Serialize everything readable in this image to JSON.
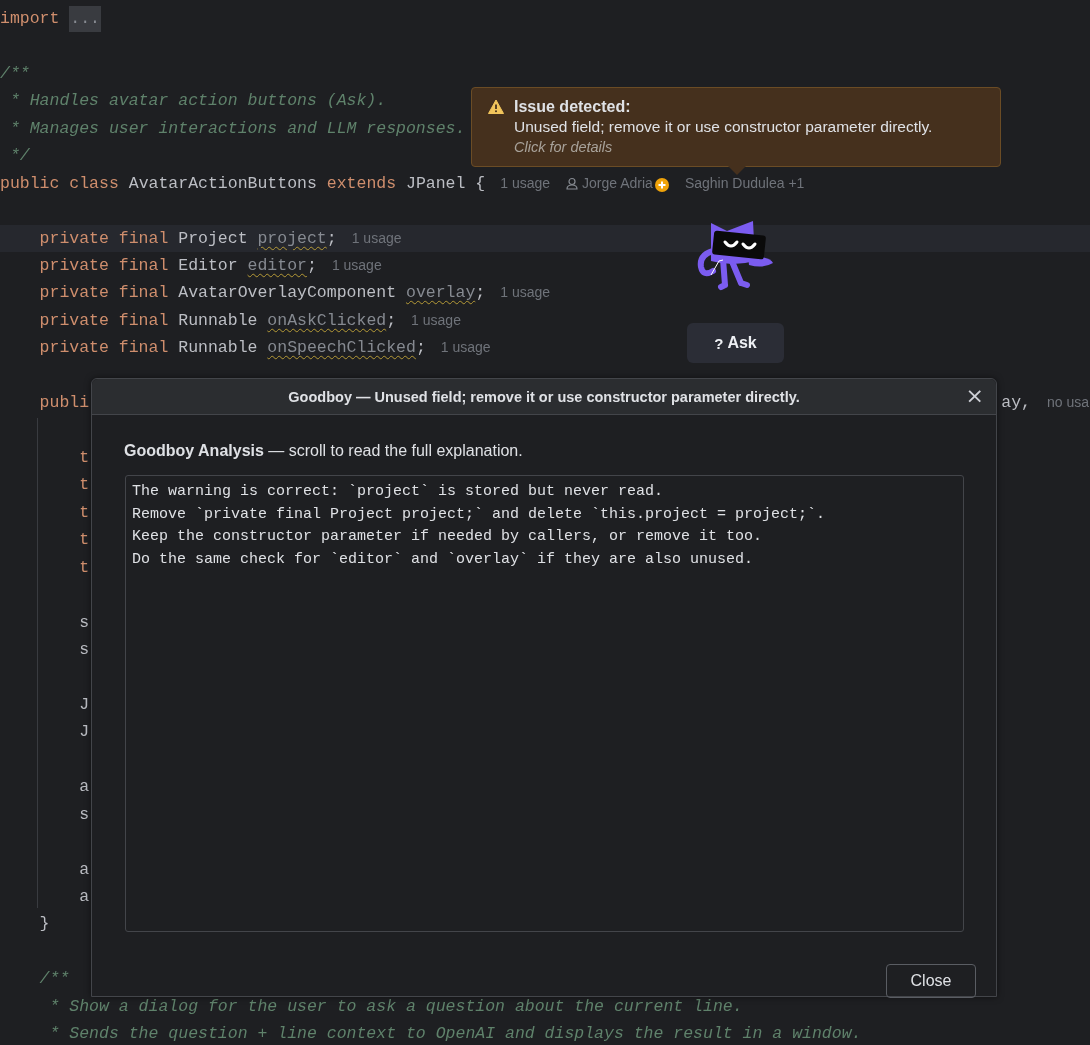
{
  "editor": {
    "lines": [
      {
        "kind": "code",
        "segments": [
          {
            "kind": "keyword",
            "text": "import "
          },
          {
            "kind": "fold",
            "text": "..."
          }
        ]
      },
      {
        "kind": "blank"
      },
      {
        "kind": "code",
        "segments": [
          {
            "kind": "comment",
            "text": "/**"
          }
        ]
      },
      {
        "kind": "code",
        "segments": [
          {
            "kind": "comment",
            "text": " * Handles avatar action buttons (Ask)."
          }
        ]
      },
      {
        "kind": "code",
        "segments": [
          {
            "kind": "comment",
            "text": " * Manages user interactions and LLM responses."
          }
        ]
      },
      {
        "kind": "code",
        "segments": [
          {
            "kind": "comment",
            "text": " */"
          }
        ]
      },
      {
        "kind": "code",
        "segments": [
          {
            "kind": "keyword",
            "text": "public class "
          },
          {
            "kind": "plain",
            "text": "AvatarActionButtons "
          },
          {
            "kind": "keyword",
            "text": "extends "
          },
          {
            "kind": "plain",
            "text": "JPanel {"
          },
          {
            "kind": "hint",
            "text": "1 usage"
          },
          {
            "kind": "author",
            "text": "Jorge Adria"
          },
          {
            "kind": "add-badge"
          },
          {
            "kind": "hint",
            "text": "Saghin Dudulea +1"
          }
        ]
      },
      {
        "kind": "blank"
      },
      {
        "kind": "code",
        "current": true,
        "segments": [
          {
            "kind": "keyword",
            "text": "    private final "
          },
          {
            "kind": "plain",
            "text": "Project "
          },
          {
            "kind": "unused",
            "text": "project"
          },
          {
            "kind": "plain",
            "text": ";"
          },
          {
            "kind": "hint",
            "text": "1 usage"
          }
        ]
      },
      {
        "kind": "code",
        "segments": [
          {
            "kind": "keyword",
            "text": "    private final "
          },
          {
            "kind": "plain",
            "text": "Editor "
          },
          {
            "kind": "unused",
            "text": "editor"
          },
          {
            "kind": "plain",
            "text": ";"
          },
          {
            "kind": "hint",
            "text": "1 usage"
          }
        ]
      },
      {
        "kind": "code",
        "segments": [
          {
            "kind": "keyword",
            "text": "    private final "
          },
          {
            "kind": "plain",
            "text": "AvatarOverlayComponent "
          },
          {
            "kind": "unused",
            "text": "overlay"
          },
          {
            "kind": "plain",
            "text": ";"
          },
          {
            "kind": "hint",
            "text": "1 usage"
          }
        ]
      },
      {
        "kind": "code",
        "segments": [
          {
            "kind": "keyword",
            "text": "    private final "
          },
          {
            "kind": "plain",
            "text": "Runnable "
          },
          {
            "kind": "unused",
            "text": "onAskClicked"
          },
          {
            "kind": "plain",
            "text": ";"
          },
          {
            "kind": "hint",
            "text": "1 usage"
          }
        ]
      },
      {
        "kind": "code",
        "segments": [
          {
            "kind": "keyword",
            "text": "    private final "
          },
          {
            "kind": "plain",
            "text": "Runnable "
          },
          {
            "kind": "unused",
            "text": "onSpeechClicked"
          },
          {
            "kind": "plain",
            "text": ";"
          },
          {
            "kind": "hint",
            "text": "1 usage"
          }
        ]
      },
      {
        "kind": "blank"
      },
      {
        "kind": "code",
        "segments": [
          {
            "kind": "keyword",
            "text": "    publi"
          }
        ],
        "tail": [
          {
            "kind": "plain",
            "text": "ay,"
          },
          {
            "kind": "hint",
            "text": "no usa"
          }
        ]
      },
      {
        "kind": "blank"
      },
      {
        "kind": "code",
        "segments": [
          {
            "kind": "keyword",
            "text": "        t"
          }
        ]
      },
      {
        "kind": "code",
        "segments": [
          {
            "kind": "keyword",
            "text": "        t"
          }
        ]
      },
      {
        "kind": "code",
        "segments": [
          {
            "kind": "keyword",
            "text": "        t"
          }
        ]
      },
      {
        "kind": "code",
        "segments": [
          {
            "kind": "keyword",
            "text": "        t"
          }
        ]
      },
      {
        "kind": "code",
        "segments": [
          {
            "kind": "keyword",
            "text": "        t"
          }
        ]
      },
      {
        "kind": "blank"
      },
      {
        "kind": "code",
        "segments": [
          {
            "kind": "plain",
            "text": "        s"
          }
        ]
      },
      {
        "kind": "code",
        "segments": [
          {
            "kind": "plain",
            "text": "        s"
          }
        ]
      },
      {
        "kind": "blank"
      },
      {
        "kind": "code",
        "segments": [
          {
            "kind": "plain",
            "text": "        J"
          }
        ]
      },
      {
        "kind": "code",
        "segments": [
          {
            "kind": "plain",
            "text": "        J"
          }
        ]
      },
      {
        "kind": "blank"
      },
      {
        "kind": "code",
        "segments": [
          {
            "kind": "plain",
            "text": "        a"
          }
        ]
      },
      {
        "kind": "code",
        "segments": [
          {
            "kind": "plain",
            "text": "        s"
          }
        ]
      },
      {
        "kind": "blank"
      },
      {
        "kind": "code",
        "segments": [
          {
            "kind": "plain",
            "text": "        a"
          }
        ]
      },
      {
        "kind": "code",
        "segments": [
          {
            "kind": "plain",
            "text": "        a"
          }
        ]
      },
      {
        "kind": "code",
        "segments": [
          {
            "kind": "plain",
            "text": "    }"
          }
        ]
      },
      {
        "kind": "blank"
      },
      {
        "kind": "code",
        "segments": [
          {
            "kind": "comment",
            "text": "    /**"
          }
        ]
      },
      {
        "kind": "code",
        "segments": [
          {
            "kind": "comment",
            "text": "     * Show a dialog for the user to ask a question about the current line."
          }
        ]
      },
      {
        "kind": "code",
        "segments": [
          {
            "kind": "comment",
            "text": "     * Sends the question + line context to OpenAI and displays the result in a window."
          }
        ]
      }
    ]
  },
  "tooltip": {
    "title": "Issue detected:",
    "message": "Unused field; remove it or use constructor parameter directly.",
    "link": "Click for details"
  },
  "ask_button": {
    "icon": "?",
    "label": "Ask"
  },
  "dialog": {
    "title": "Goodboy — Unused field; remove it or use constructor parameter directly.",
    "close_icon": "×",
    "heading": "**Goodboy Analysis** — scroll to read the full explanation.",
    "explanation": "The warning is correct: `project` is stored but never read.\nRemove `private final Project project;` and delete `this.project = project;`.\nKeep the constructor parameter if needed by callers, or remove it too.\nDo the same check for `editor` and `overlay` if they are also unused.",
    "buttons": [
      "Close"
    ]
  }
}
